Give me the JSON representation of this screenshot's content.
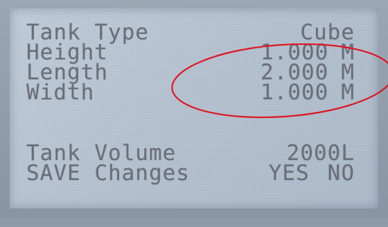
{
  "display": {
    "rows": [
      {
        "label": "Tank Type",
        "value": "Cube",
        "unit": ""
      },
      {
        "label": "Height",
        "value": "1.000",
        "unit": "M"
      },
      {
        "label": "Length",
        "value": "2.000",
        "unit": "M"
      },
      {
        "label": "Width",
        "value": "1.000",
        "unit": "M"
      }
    ],
    "volume": {
      "label": "Tank Volume",
      "value": "2000L"
    },
    "save": {
      "label": "SAVE Changes",
      "yes": "YES",
      "no": "NO"
    }
  },
  "colors": {
    "lcd_text": "#6b6e78",
    "lcd_background": "#b8c4d2",
    "annotation": "#e0141e"
  }
}
